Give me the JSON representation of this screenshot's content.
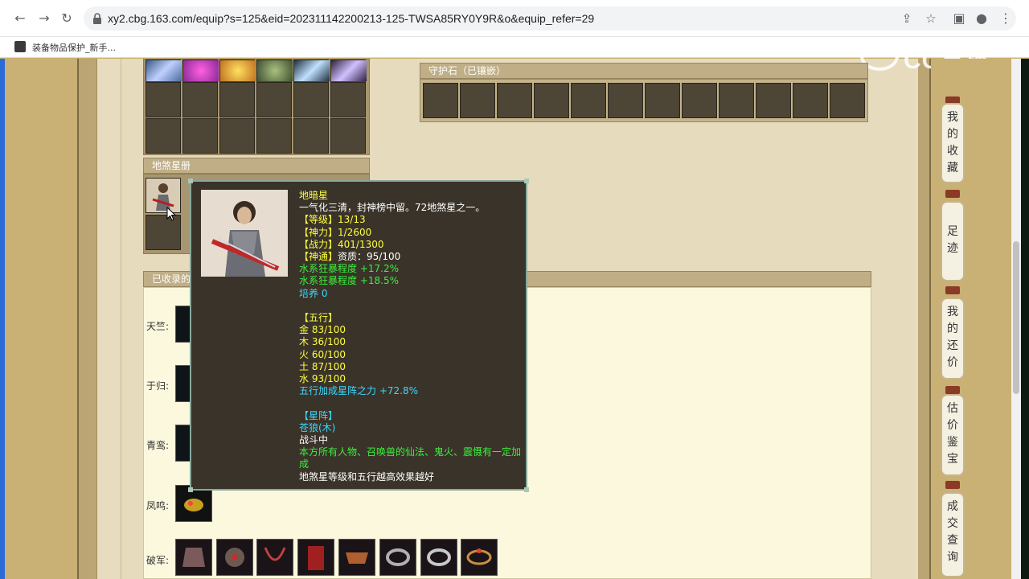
{
  "browser": {
    "url": "xy2.cbg.163.com/equip?s=125&eid=202311142200213-125-TWSA85RY0Y9R&o&equip_refer=29",
    "bookmark_label": "装备物品保护_新手...",
    "watermark": "CC直播"
  },
  "sections": {
    "guard_stone_title": "守护石（已镶嵌）",
    "star_book_title": "地煞星册",
    "collected_title": "已收录的"
  },
  "collected_rows": [
    {
      "label": "天竺:"
    },
    {
      "label": "于归:"
    },
    {
      "label": "青鸾:"
    },
    {
      "label": "凤鸣:"
    },
    {
      "label": "破军:"
    }
  ],
  "sidebar": {
    "items": [
      {
        "label": "我的收藏",
        "chars": [
          "我",
          "的",
          "收",
          "藏"
        ]
      },
      {
        "label": "足迹",
        "chars": [
          "足",
          "迹"
        ]
      },
      {
        "label": "我的还价",
        "chars": [
          "我",
          "的",
          "还",
          "价"
        ]
      },
      {
        "label": "估价鉴宝",
        "chars": [
          "估",
          "价",
          "鉴",
          "宝"
        ]
      },
      {
        "label": "成交查询",
        "chars": [
          "成",
          "交",
          "查",
          "询"
        ]
      }
    ]
  },
  "tooltip": {
    "name": "地暗星",
    "desc": "一气化三清，封神榜中留。72地煞星之一。",
    "level": "【等级】13/13",
    "shenli": "【神力】1/2600",
    "zhanli": "【战力】401/1300",
    "shentong_prefix": "【神通】",
    "shentong_value": "资质：95/100",
    "attr1": "水系狂暴程度 +17.2%",
    "attr2": "水系狂暴程度 +18.5%",
    "peiyang": "培养 0",
    "wuxing_title": "【五行】",
    "jin": "金 83/100",
    "mu": "木 36/100",
    "huo": "火 60/100",
    "tu": "土 87/100",
    "shui": "水 93/100",
    "wuxing_bonus": "五行加成星阵之力 +72.8%",
    "xingzhen_title": "【星阵】",
    "xingzhen_name": "苍狼(木)",
    "in_battle": "战斗中",
    "effect": "本方所有人物、召唤兽的仙法、鬼火、震慑有一定加成",
    "note": "地煞星等级和五行越高效果越好"
  },
  "colors": {
    "tooltip_bg": "#3a332a",
    "yellow": "#ffff40",
    "green": "#3cf03c",
    "cyan": "#3ad8ff"
  }
}
